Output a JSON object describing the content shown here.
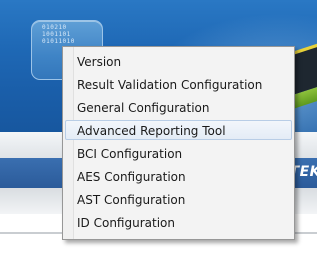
{
  "background": {
    "tile_text": [
      "010210",
      "1001101",
      "01011010"
    ],
    "banner_label": "TEK"
  },
  "context_menu": {
    "items": [
      {
        "label": "Version"
      },
      {
        "label": "Result Validation Configuration"
      },
      {
        "label": "General Configuration"
      },
      {
        "label": "Advanced Reporting Tool",
        "highlighted": true
      },
      {
        "label": "BCI Configuration"
      },
      {
        "label": "AES Configuration"
      },
      {
        "label": "AST Configuration"
      },
      {
        "label": "ID Configuration"
      }
    ]
  },
  "colors": {
    "banner_blue": "#1f69b6",
    "menu_background": "#f3f3f3",
    "highlight_border": "#b8cde6"
  }
}
